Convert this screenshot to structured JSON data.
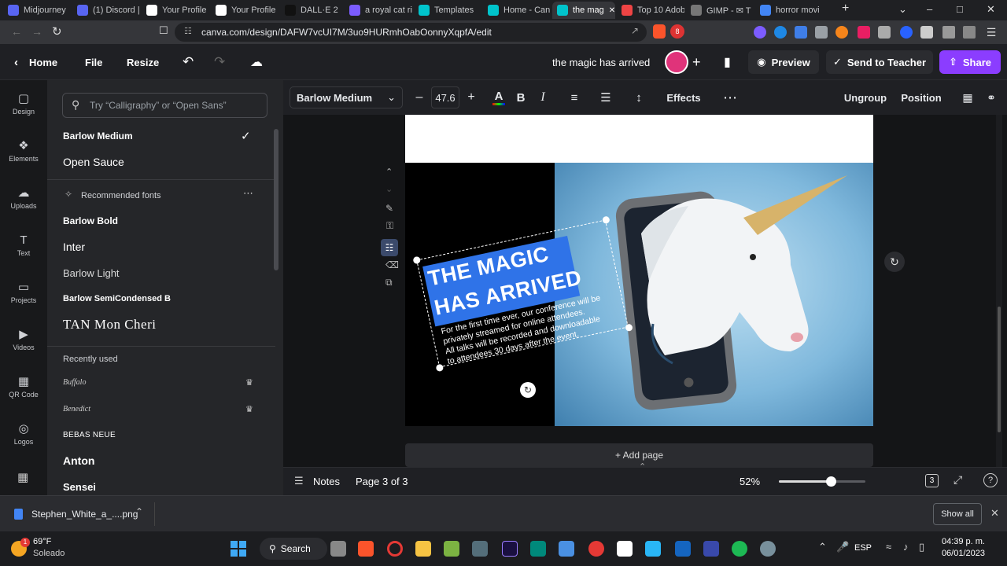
{
  "browser": {
    "tabs": [
      {
        "label": "Midjourney",
        "color": "#5865f2"
      },
      {
        "label": "(1) Discord |",
        "color": "#5865f2"
      },
      {
        "label": "Your Profile",
        "color": "#ffffff"
      },
      {
        "label": "Your Profile",
        "color": "#ffffff"
      },
      {
        "label": "DALL·E 2",
        "color": "#111111"
      },
      {
        "label": "a royal cat ri",
        "color": "#7b5cff"
      },
      {
        "label": "Templates",
        "color": "#00c4cc"
      },
      {
        "label": "Home - Can",
        "color": "#00c4cc"
      },
      {
        "label": "the mag",
        "color": "#00c4cc"
      },
      {
        "label": "Top 10 Adob",
        "color": "#e44"
      },
      {
        "label": "GIMP - ✉ T",
        "color": "#777"
      },
      {
        "label": "horror movi",
        "color": "#4285f4"
      }
    ],
    "active_tab_index": 8,
    "url": "canva.com/design/DAFW7vcUI7M/3uo9HURmhOabOonnyXqpfA/edit",
    "extension_badge": "8"
  },
  "header": {
    "home": "Home",
    "file": "File",
    "resize": "Resize",
    "design_title": "the magic has arrived",
    "preview": "Preview",
    "send": "Send to Teacher",
    "share": "Share"
  },
  "rail": [
    {
      "label": "Design",
      "icon": "▢"
    },
    {
      "label": "Elements",
      "icon": "❖"
    },
    {
      "label": "Uploads",
      "icon": "☁"
    },
    {
      "label": "Text",
      "icon": "T"
    },
    {
      "label": "Projects",
      "icon": "▭"
    },
    {
      "label": "Videos",
      "icon": "▶"
    },
    {
      "label": "QR Code",
      "icon": "▦"
    },
    {
      "label": "Logos",
      "icon": "◎"
    }
  ],
  "font_panel": {
    "search_placeholder": "Try “Calligraphy” or “Open Sans”",
    "current": [
      "Barlow Medium",
      "Open Sauce"
    ],
    "recommended_heading": "Recommended fonts",
    "recommended": [
      "Barlow Bold",
      "Inter",
      "Barlow Light",
      "Barlow SemiCondensed B",
      "TAN Mon Cheri"
    ],
    "recent_heading": "Recently used",
    "recent": [
      "Buffalo",
      "Benedict",
      "BEBAS NEUE",
      "Anton",
      "Sensei"
    ]
  },
  "toolbar": {
    "font": "Barlow Medium",
    "size": "47.6",
    "effects": "Effects",
    "ungroup": "Ungroup",
    "position": "Position"
  },
  "design": {
    "headline_line1": "THE MAGIC",
    "headline_line2": "HAS ARRIVED",
    "body_line1": "For the first time ever, our conference will be",
    "body_line2": "privately streamed for online attendees.",
    "body_line3": "All talks will be recorded and downloadable",
    "body_line4": "to attendees 30 days after the event.",
    "add_page": "+ Add page"
  },
  "bottom": {
    "notes": "Notes",
    "page": "Page 3 of 3",
    "zoom": "52%",
    "zoom_fraction": 0.6,
    "page_count": "3"
  },
  "downloads": {
    "file": "Stephen_White_a_....png",
    "show_all": "Show all"
  },
  "taskbar": {
    "temp": "69°F",
    "weather": "Soleado",
    "search": "Search",
    "lang": "ESP",
    "time": "04:39 p. m.",
    "date": "06/01/2023",
    "weather_badge": "1"
  }
}
